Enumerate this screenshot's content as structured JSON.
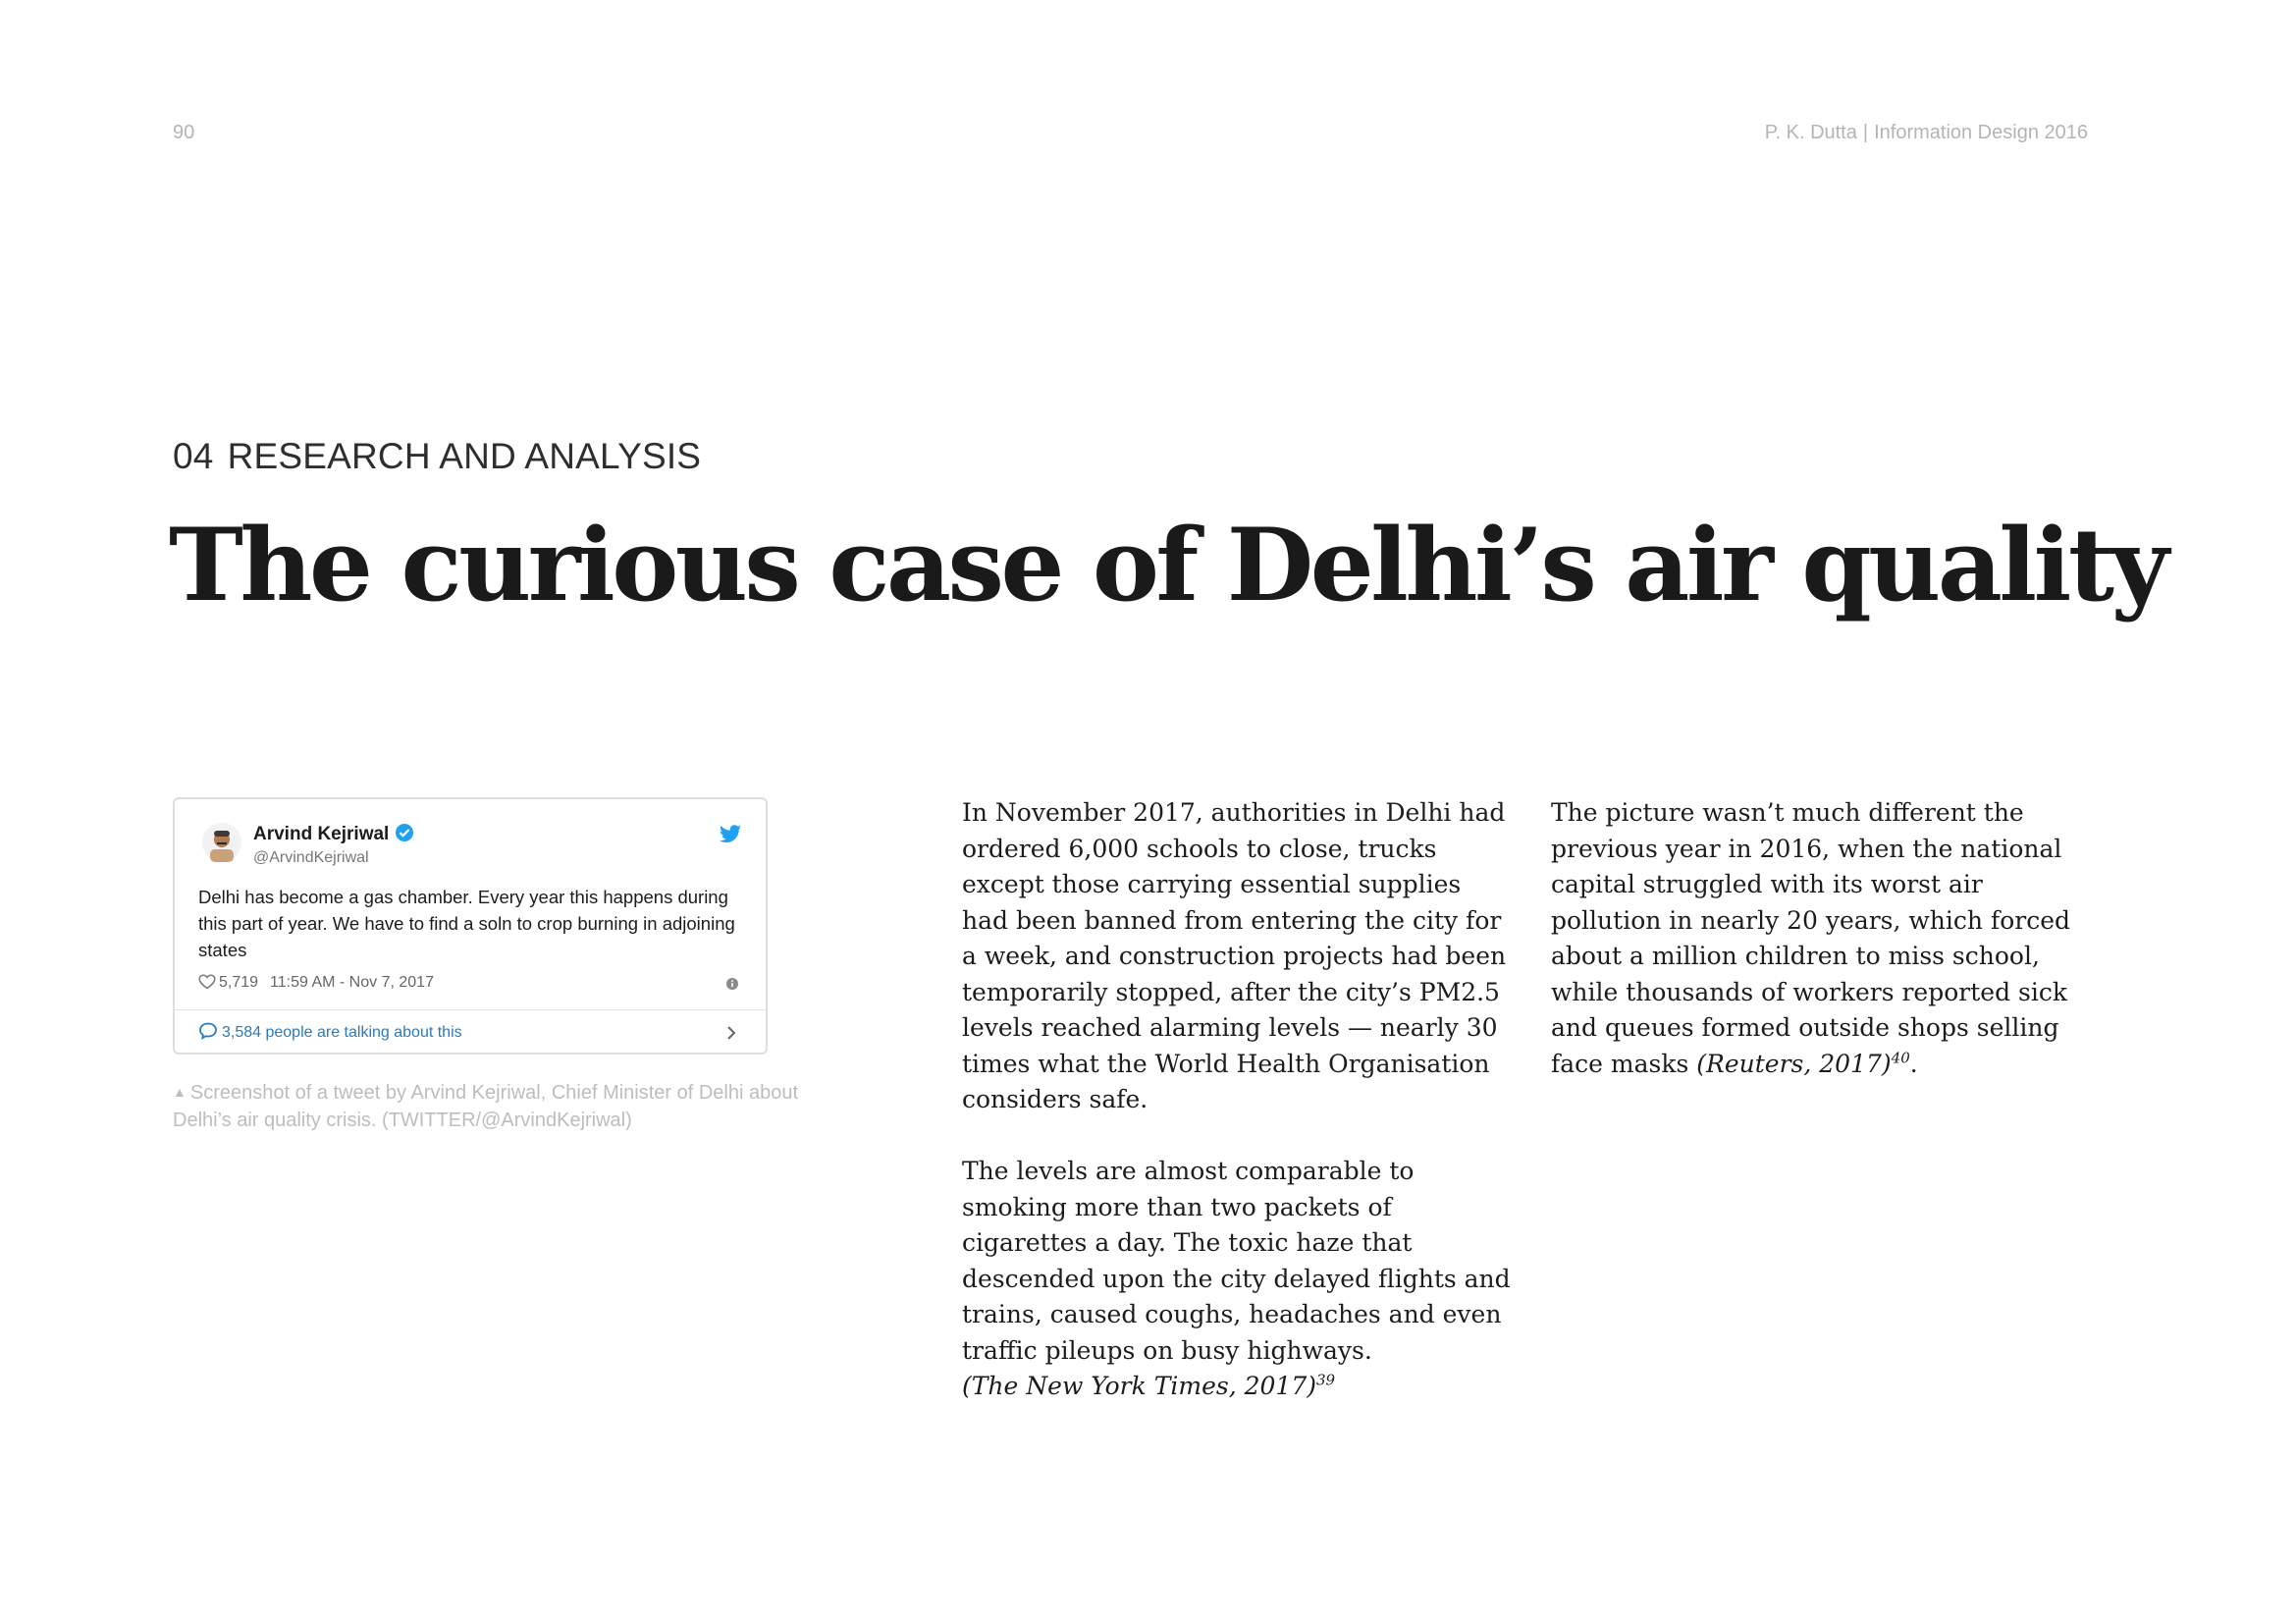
{
  "header": {
    "page_number": "90",
    "author": "P. K. Dutta",
    "separator": "|",
    "publication": "Information Design 2016"
  },
  "section": {
    "number": "04",
    "label": "RESEARCH AND ANALYSIS"
  },
  "title": "The curious case of Delhi’s air quality",
  "tweet": {
    "name": "Arvind Kejriwal",
    "handle": "@ArvindKejriwal",
    "text": "Delhi has become a gas chamber. Every year this happens during this part of year. We have to find a soln to crop burning in adjoining states",
    "likes": "5,719",
    "timestamp": "11:59 AM - Nov 7, 2017",
    "talking": "3,584 people are talking about this",
    "accent_color": "#1da1f2",
    "link_color": "#2b7bb9"
  },
  "caption": {
    "marker": "▲",
    "text": "Screenshot of a tweet by Arvind Kejriwal, Chief Minister of Delhi about Delhi’s air quality crisis. (TWITTER/@ArvindKejriwal)"
  },
  "body": {
    "col1_p1": "In November 2017, authorities in Delhi had ordered 6,000 schools to close, trucks except those carrying essential supplies had been banned from entering the city for a week, and construction projects had been temporarily stopped, after the city’s PM2.5 levels reached alarming levels — nearly 30 times what the World Health Organisation considers safe.",
    "col1_p2": "The levels are almost comparable to smoking more than two packets of cigarettes a day. The toxic haze that descended upon the city delayed flights and trains, caused coughs, headaches and even traffic pileups on busy highways.",
    "col1_cite": "(The New York Times, 2017)",
    "col1_cite_ref": "39",
    "col2_p1": "The picture wasn’t much different the previous year in 2016, when the national capital struggled with its worst air pollution in nearly 20 years, which forced about a million children to miss school, while thousands of workers reported sick and queues formed outside shops selling face masks",
    "col2_cite": "(Reuters, 2017)",
    "col2_cite_ref": "40",
    "col2_end": "."
  }
}
